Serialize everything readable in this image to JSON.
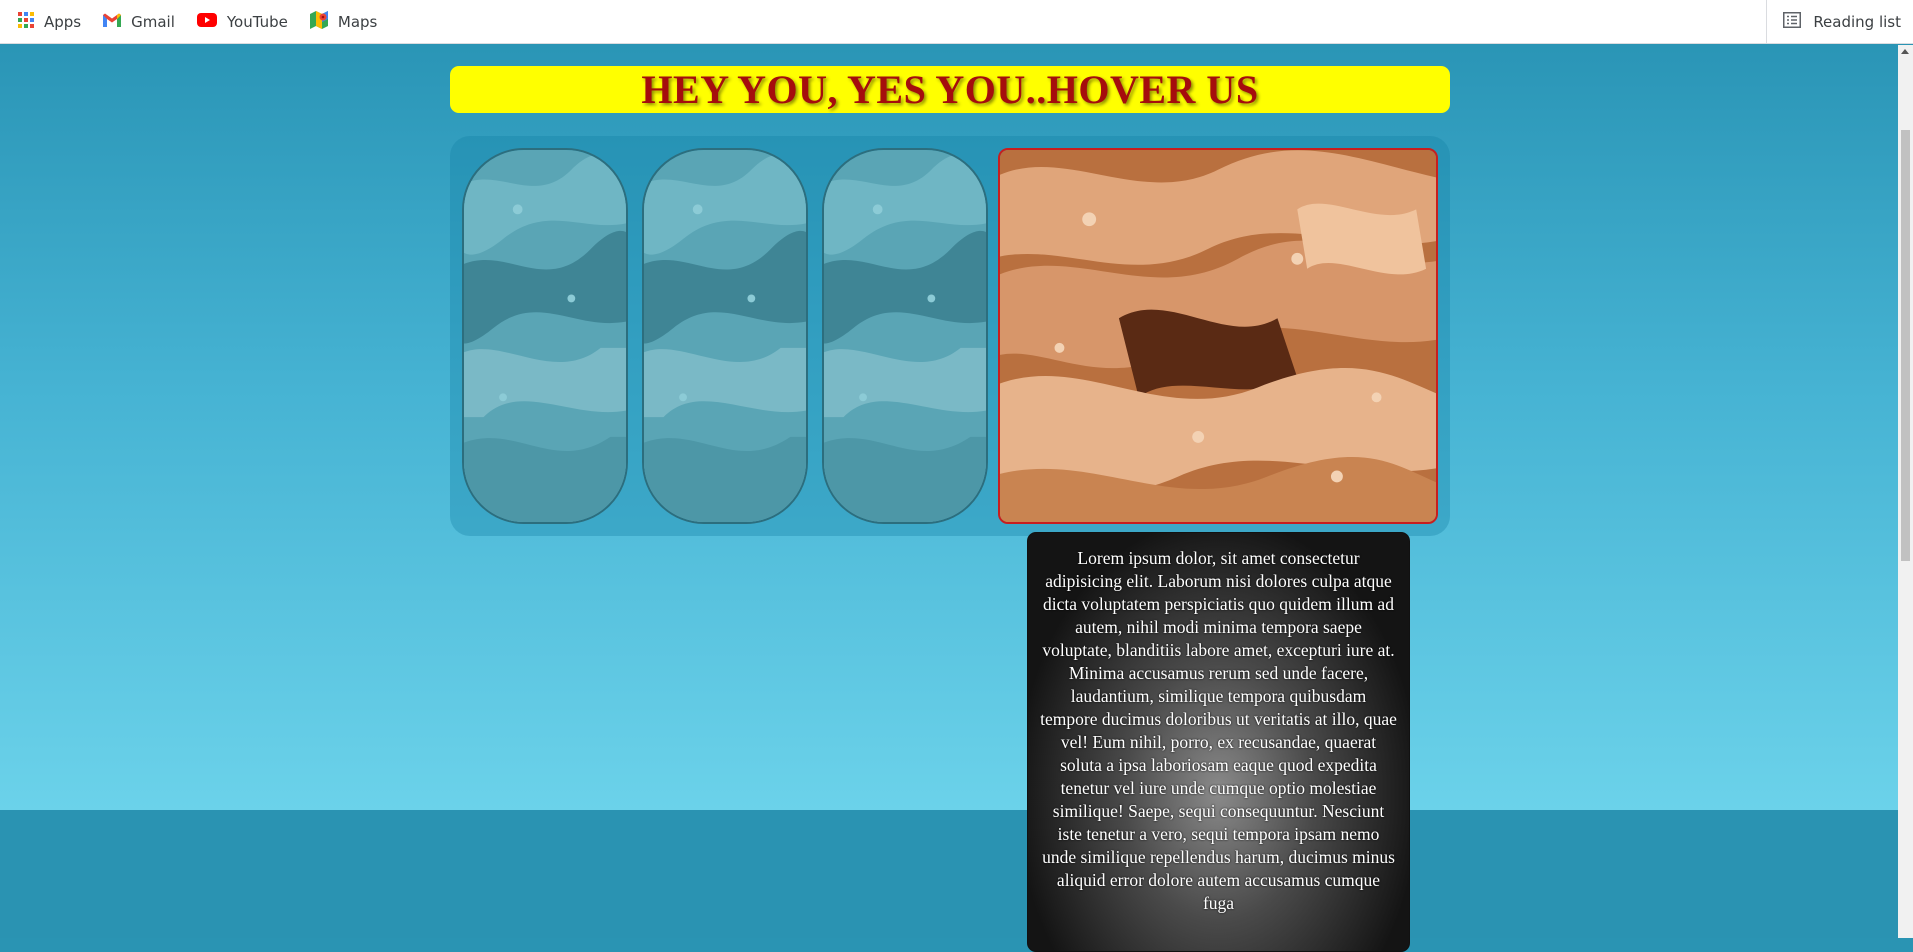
{
  "bookmarks": {
    "items": [
      {
        "label": "Apps",
        "icon": "apps-grid-icon"
      },
      {
        "label": "Gmail",
        "icon": "gmail-icon"
      },
      {
        "label": "YouTube",
        "icon": "youtube-icon"
      },
      {
        "label": "Maps",
        "icon": "maps-icon"
      }
    ],
    "reading_list_label": "Reading list"
  },
  "banner": {
    "title": "HEY YOU, YES YOU..HOVER US"
  },
  "gallery": {
    "cards": [
      {
        "state": "inactive",
        "tint": "#4f9fb0"
      },
      {
        "state": "inactive",
        "tint": "#4f9fb0"
      },
      {
        "state": "inactive",
        "tint": "#4f9fb0"
      },
      {
        "state": "hovered",
        "tint": "#c07a4a"
      }
    ]
  },
  "description": {
    "text": "Lorem ipsum dolor, sit amet consectetur adipisicing elit. Laborum nisi dolores culpa atque dicta voluptatem perspiciatis quo quidem illum ad autem, nihil modi minima tempora saepe voluptate, blanditiis labore amet, excepturi iure at. Minima accusamus rerum sed unde facere, laudantium, similique tempora quibusdam tempore ducimus doloribus ut veritatis at illo, quae vel! Eum nihil, porro, ex recusandae, quaerat soluta a ipsa laboriosam eaque quod expedita tenetur vel iure unde cumque optio molestiae similique! Saepe, sequi consequuntur. Nesciunt iste tenetur a vero, sequi tempora ipsam nemo unde similique repellendus harum, ducimus minus aliquid error dolore autem accusamus cumque fuga"
  },
  "colors": {
    "banner_bg": "#ffff00",
    "banner_text": "#a50d0d",
    "page_top": "#2a95b6",
    "page_bottom": "#6bd2ea",
    "active_border": "#c81e1e"
  }
}
